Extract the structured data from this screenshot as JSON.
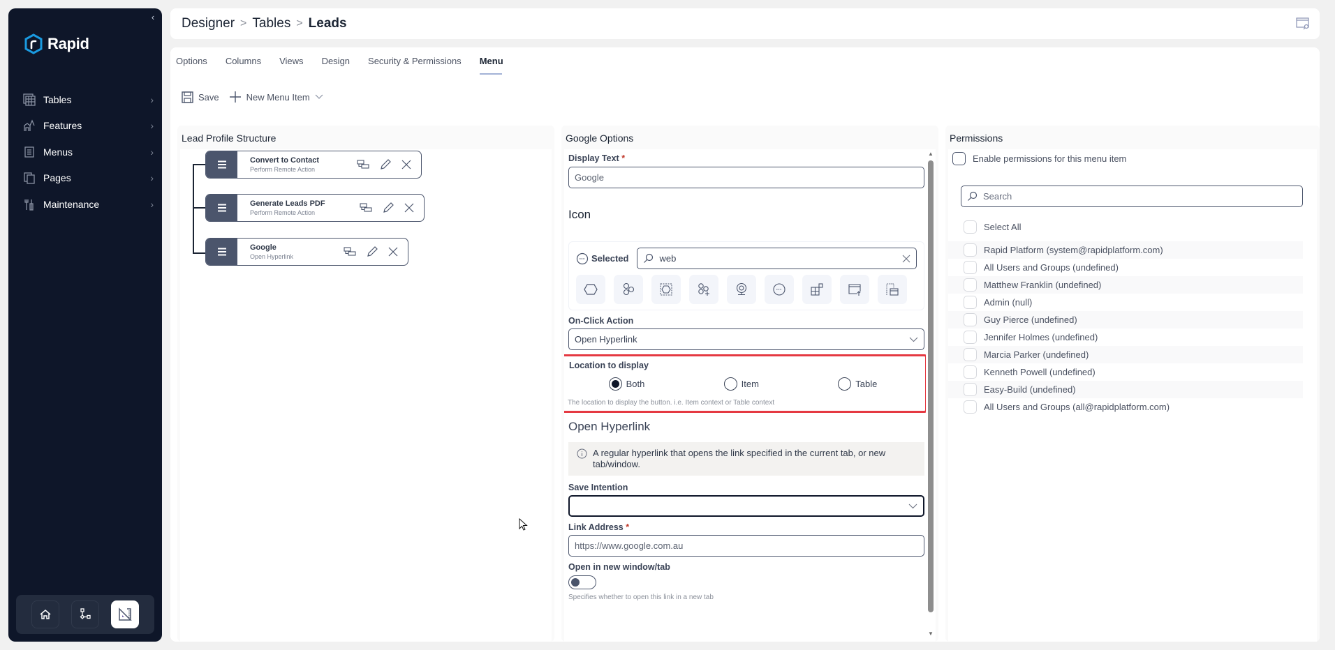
{
  "app": {
    "brand": "Rapid",
    "brand_color": "#1a9ae0",
    "accent_color": "#4b556c",
    "highlight_color": "#e53942"
  },
  "sidebar": {
    "items": [
      {
        "label": "Tables",
        "icon": "table-icon"
      },
      {
        "label": "Features",
        "icon": "features-icon"
      },
      {
        "label": "Menus",
        "icon": "menu-icon"
      },
      {
        "label": "Pages",
        "icon": "pages-icon"
      },
      {
        "label": "Maintenance",
        "icon": "maintenance-icon"
      }
    ],
    "bottom_buttons": [
      {
        "name": "home",
        "icon": "home-icon"
      },
      {
        "name": "workflow",
        "icon": "workflow-icon"
      },
      {
        "name": "designer",
        "icon": "designer-icon",
        "active": true
      }
    ]
  },
  "header": {
    "breadcrumb": [
      "Designer",
      "Tables",
      "Leads"
    ]
  },
  "tabs": [
    {
      "label": "Options"
    },
    {
      "label": "Columns"
    },
    {
      "label": "Views"
    },
    {
      "label": "Design"
    },
    {
      "label": "Security & Permissions"
    },
    {
      "label": "Menu",
      "active": true
    }
  ],
  "toolbar": {
    "save_label": "Save",
    "new_item_label": "New Menu Item"
  },
  "structure": {
    "title": "Lead Profile Structure",
    "items": [
      {
        "title": "Convert to Contact",
        "subtitle": "Perform Remote Action"
      },
      {
        "title": "Generate Leads PDF",
        "subtitle": "Perform Remote Action"
      },
      {
        "title": "Google",
        "subtitle": "Open Hyperlink"
      }
    ]
  },
  "options": {
    "title": "Google Options",
    "display_text_label": "Display Text",
    "display_text_value": "Google",
    "icon_heading": "Icon",
    "icon_selected_label": "Selected",
    "icon_search_value": "web",
    "icon_results": [
      "hexagon",
      "hexagons",
      "hexagon-select",
      "hexagon-add",
      "webcam",
      "ellipsis-circle",
      "web-blocks",
      "window-upload",
      "window-dashed"
    ],
    "on_click_label": "On-Click Action",
    "on_click_value": "Open Hyperlink",
    "location_label": "Location to display",
    "location_options": [
      "Both",
      "Item",
      "Table"
    ],
    "location_selected": "Both",
    "location_hint": "The location to display the button. i.e. Item context or Table context",
    "hyperlink_heading": "Open Hyperlink",
    "hyperlink_info": "A regular hyperlink that opens the link specified in the current tab, or new tab/window.",
    "save_intention_label": "Save Intention",
    "save_intention_value": "",
    "link_address_label": "Link Address",
    "link_address_value": "https://www.google.com.au",
    "new_window_label": "Open in new window/tab",
    "new_window_on": false,
    "new_window_hint": "Specifies whether to open this link in a new tab"
  },
  "permissions": {
    "title": "Permissions",
    "enable_label": "Enable permissions for this menu item",
    "search_placeholder": "Search",
    "select_all_label": "Select All",
    "entries": [
      "Rapid Platform (system@rapidplatform.com)",
      "All Users and Groups (undefined)",
      "Matthew Franklin (undefined)",
      "Admin (null)",
      "Guy Pierce (undefined)",
      "Jennifer Holmes (undefined)",
      "Marcia Parker (undefined)",
      "Kenneth Powell (undefined)",
      "Easy-Build (undefined)",
      "All Users and Groups (all@rapidplatform.com)"
    ]
  }
}
